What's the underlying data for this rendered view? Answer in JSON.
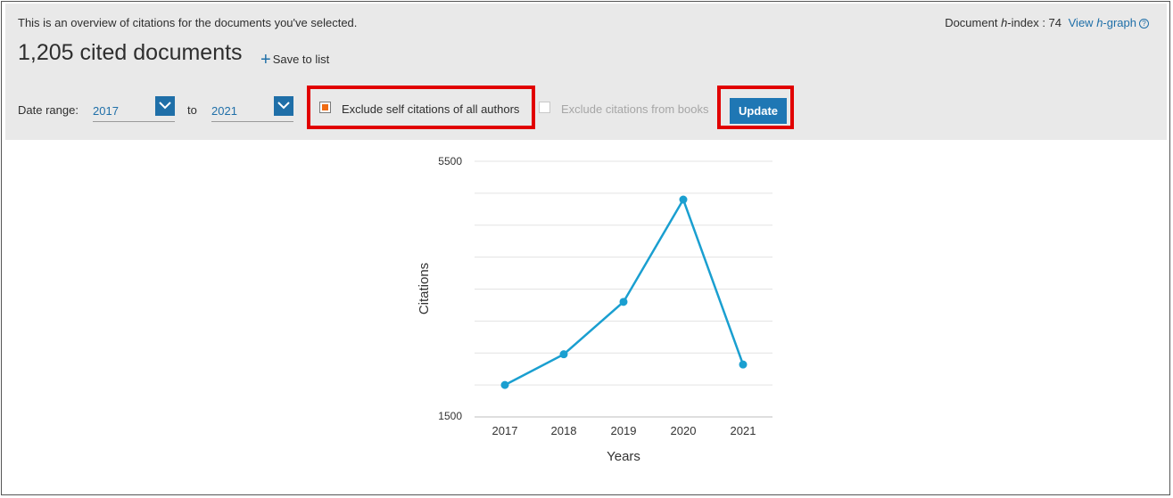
{
  "header": {
    "overview_text": "This is an overview of citations for the documents you've selected.",
    "hindex_prefix": "Document ",
    "hindex_h": "h",
    "hindex_suffix": "-index : 74",
    "view_prefix": "View ",
    "view_h": "h",
    "view_suffix": "-graph",
    "title": "1,205 cited documents",
    "save_label": "Save to list"
  },
  "filters": {
    "date_range_label": "Date range:",
    "from_value": "2017",
    "to_label": "to",
    "to_value": "2021",
    "exclude_self_label": "Exclude self citations of all authors",
    "exclude_self_checked": true,
    "exclude_books_label": "Exclude citations from books",
    "exclude_books_checked": false,
    "update_label": "Update"
  },
  "colors": {
    "accent": "#1f77b4",
    "highlight": "#e10000",
    "checkbox_fill": "#f06b12",
    "line": "#1a9fd0"
  },
  "chart_data": {
    "type": "line",
    "x": [
      "2017",
      "2018",
      "2019",
      "2020",
      "2021"
    ],
    "series": [
      {
        "values": [
          2000,
          2480,
          3300,
          4900,
          2320
        ]
      }
    ],
    "xlabel": "Years",
    "ylabel": "Citations",
    "ylim": [
      1500,
      5500
    ],
    "y_tick_labels": [
      "5500",
      "1500"
    ],
    "grid": true
  }
}
